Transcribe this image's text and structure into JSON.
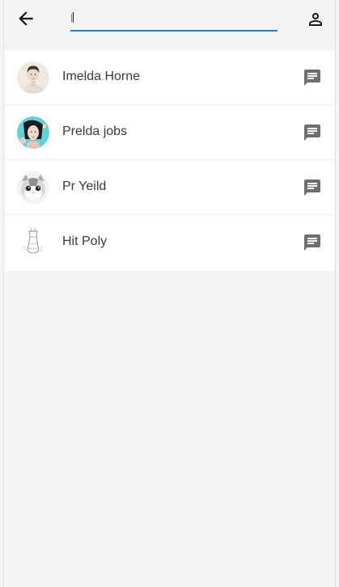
{
  "header": {
    "search_value": "l",
    "back_icon": "arrow-left-icon",
    "profile_icon": "person-icon"
  },
  "accent_color": "#1a87c9",
  "contacts": [
    {
      "name": "Imelda Horne",
      "avatar": "portrait-photo",
      "action_icon": "chat-icon"
    },
    {
      "name": "Prelda jobs",
      "avatar": "portrait-photo",
      "action_icon": "chat-icon"
    },
    {
      "name": "Pr Yeild",
      "avatar": "cat-photo",
      "action_icon": "chat-icon"
    },
    {
      "name": "Hit Poly",
      "avatar": "sketch-photo",
      "action_icon": "chat-icon"
    }
  ]
}
